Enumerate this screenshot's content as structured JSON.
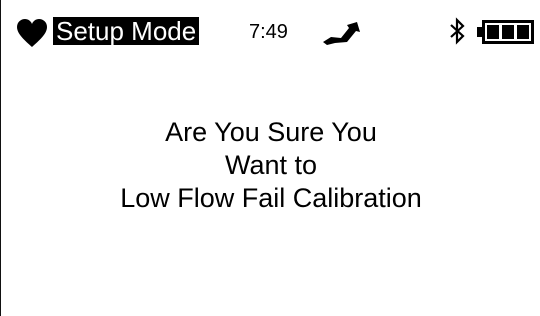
{
  "status_bar": {
    "mode_label": "Setup Mode",
    "time": "7:49",
    "icons": {
      "heart": "heart-icon",
      "flow": "flow-icon",
      "bluetooth": "bluetooth-icon",
      "battery": "battery-icon"
    },
    "battery_level": 1.0
  },
  "dialog": {
    "lines": [
      "Are You Sure You",
      "Want to",
      "Low Flow Fail Calibration"
    ]
  },
  "colors": {
    "foreground": "#000000",
    "background": "#ffffff"
  }
}
